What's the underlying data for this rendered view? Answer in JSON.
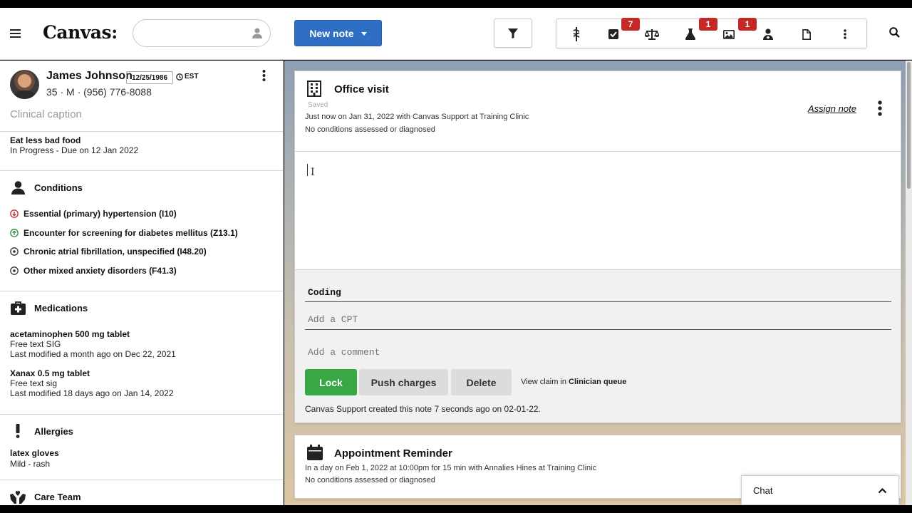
{
  "header": {
    "logo": "Canvas:",
    "search": {
      "value": "",
      "placeholder": ""
    },
    "new_note_label": "New note",
    "badges": {
      "tasks": "7",
      "imaging": "1",
      "labs": "1"
    }
  },
  "patient": {
    "name": "James Johnson",
    "dob": "12/25/1986",
    "timezone": "EST",
    "info": "35 · M · (956) 776-8088",
    "caption": "Clinical caption"
  },
  "goal": {
    "title": "Eat less bad food",
    "status": "In Progress - Due on 12 Jan 2022"
  },
  "conditions": {
    "title": "Conditions",
    "items": [
      {
        "label": "Essential (primary) hypertension (I10)",
        "trend": "down",
        "color": "#c62828"
      },
      {
        "label": "Encounter for screening for diabetes mellitus (Z13.1)",
        "trend": "up",
        "color": "#2e8b3a"
      },
      {
        "label": "Chronic atrial fibrillation, unspecified (I48.20)",
        "trend": "stable",
        "color": "#333333"
      },
      {
        "label": "Other mixed anxiety disorders (F41.3)",
        "trend": "stable",
        "color": "#333333"
      }
    ]
  },
  "medications": {
    "title": "Medications",
    "items": [
      {
        "name": "acetaminophen 500 mg tablet",
        "sig": "Free text SIG",
        "modified": "Last modified a month ago on Dec 22, 2021"
      },
      {
        "name": "Xanax 0.5 mg tablet",
        "sig": "Free text sig",
        "modified": "Last modified 18 days ago on Jan 14, 2022"
      }
    ]
  },
  "allergies": {
    "title": "Allergies",
    "items": [
      {
        "name": "latex gloves",
        "reaction": "Mild - rash"
      }
    ]
  },
  "care_team": {
    "title": "Care Team"
  },
  "note": {
    "title": "Office visit",
    "status": "Saved",
    "meta": "Just now on Jan 31, 2022 with Canvas Support at Training Clinic",
    "diagnoses": "No conditions assessed or diagnosed",
    "assign_label": "Assign note",
    "body_cursor": "I",
    "coding": {
      "title": "Coding",
      "cpt_placeholder": "Add a CPT",
      "comment_placeholder": "Add a comment"
    },
    "buttons": {
      "lock": "Lock",
      "push": "Push charges",
      "delete": "Delete"
    },
    "view_claim_prefix": "View claim in ",
    "view_claim_link": "Clinician queue",
    "created": "Canvas Support created this note 7 seconds ago on 02-01-22."
  },
  "appointment": {
    "title": "Appointment Reminder",
    "meta": "In a day on Feb 1, 2022 at 10:00pm for 15 min with Annalies Hines at Training Clinic",
    "diagnoses": "No conditions assessed or diagnosed"
  },
  "chat": {
    "label": "Chat"
  },
  "colors": {
    "primary": "#2e6fc4",
    "lock": "#38a845",
    "badge": "#c62828"
  },
  "icons": [
    "menu-icon",
    "person-icon",
    "filter-icon",
    "caduceus-icon",
    "checkbox-icon",
    "scale-icon",
    "flask-icon",
    "image-icon",
    "doctor-icon",
    "document-icon",
    "kebab-icon",
    "search-icon",
    "building-icon",
    "calendar-icon",
    "chevron-up-icon"
  ]
}
